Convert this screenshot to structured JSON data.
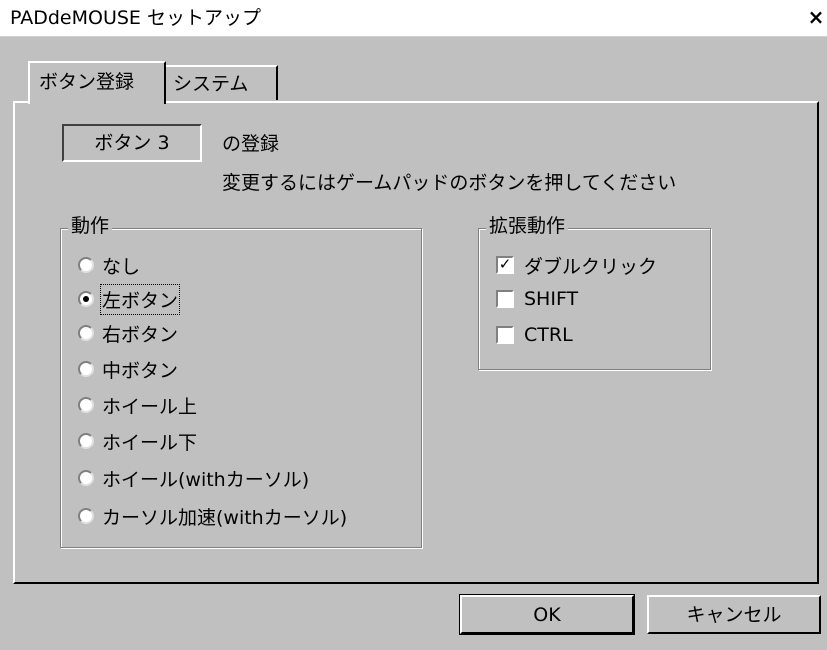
{
  "window": {
    "title": "PADdeMOUSE セットアップ",
    "close_symbol": "×"
  },
  "tabs": [
    {
      "label": "ボタン登録",
      "active": true
    },
    {
      "label": "システム",
      "active": false
    }
  ],
  "button_registration": {
    "current_button": "ボタン 3",
    "registration_label": "の登録",
    "instruction": "変更するにはゲームパッドのボタンを押してください"
  },
  "action_group": {
    "title": "動作",
    "options": [
      {
        "label": "なし",
        "selected": false
      },
      {
        "label": "左ボタン",
        "selected": true
      },
      {
        "label": "右ボタン",
        "selected": false
      },
      {
        "label": "中ボタン",
        "selected": false
      },
      {
        "label": "ホイール上",
        "selected": false
      },
      {
        "label": "ホイール下",
        "selected": false
      },
      {
        "label": "ホイール(withカーソル)",
        "selected": false
      },
      {
        "label": "カーソル加速(withカーソル)",
        "selected": false
      }
    ]
  },
  "extended_group": {
    "title": "拡張動作",
    "options": [
      {
        "label": "ダブルクリック",
        "checked": true
      },
      {
        "label": "SHIFT",
        "checked": false
      },
      {
        "label": "CTRL",
        "checked": false
      }
    ]
  },
  "check_mark": "✓",
  "buttons": {
    "ok": "OK",
    "cancel": "キャンセル"
  }
}
